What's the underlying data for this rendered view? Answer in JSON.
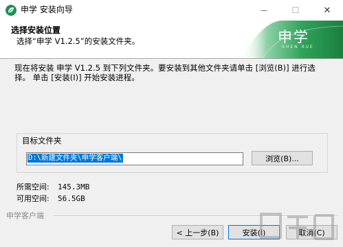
{
  "window": {
    "title": "申学 安装向导",
    "controls": {
      "minimize": "—",
      "maximize": "☐",
      "close": "✕"
    }
  },
  "header": {
    "title": "选择安装位置",
    "subtitle": "选择“申学 V1.2.5”的安装文件夹。",
    "brand_name": "申学",
    "brand_sub": "SHEN XUE"
  },
  "body": {
    "description": "现在将安装 申学 V1.2.5 到下列文件夹。要安装到其他文件夹请单击 [浏览(B)] 进行选择。 单击 [安装(I)] 开始安装进程。",
    "target_label": "目标文件夹",
    "path_value": "D:\\新建文件夹\\申学客户端\\",
    "browse_label": "浏览(B)...",
    "required_label": "所需空间:",
    "required_value": "145.3MB",
    "available_label": "可用空间:",
    "available_value": "56.5GB"
  },
  "footer": {
    "brand": "申学客户端",
    "back_label": "< 上一步(B)",
    "install_label": "安装(I)",
    "cancel_label": "取消(C)"
  },
  "colors": {
    "accent": "#0078d7",
    "brand_green": "#2e9b4a"
  },
  "icons": {
    "app": "app-leaf-icon"
  }
}
